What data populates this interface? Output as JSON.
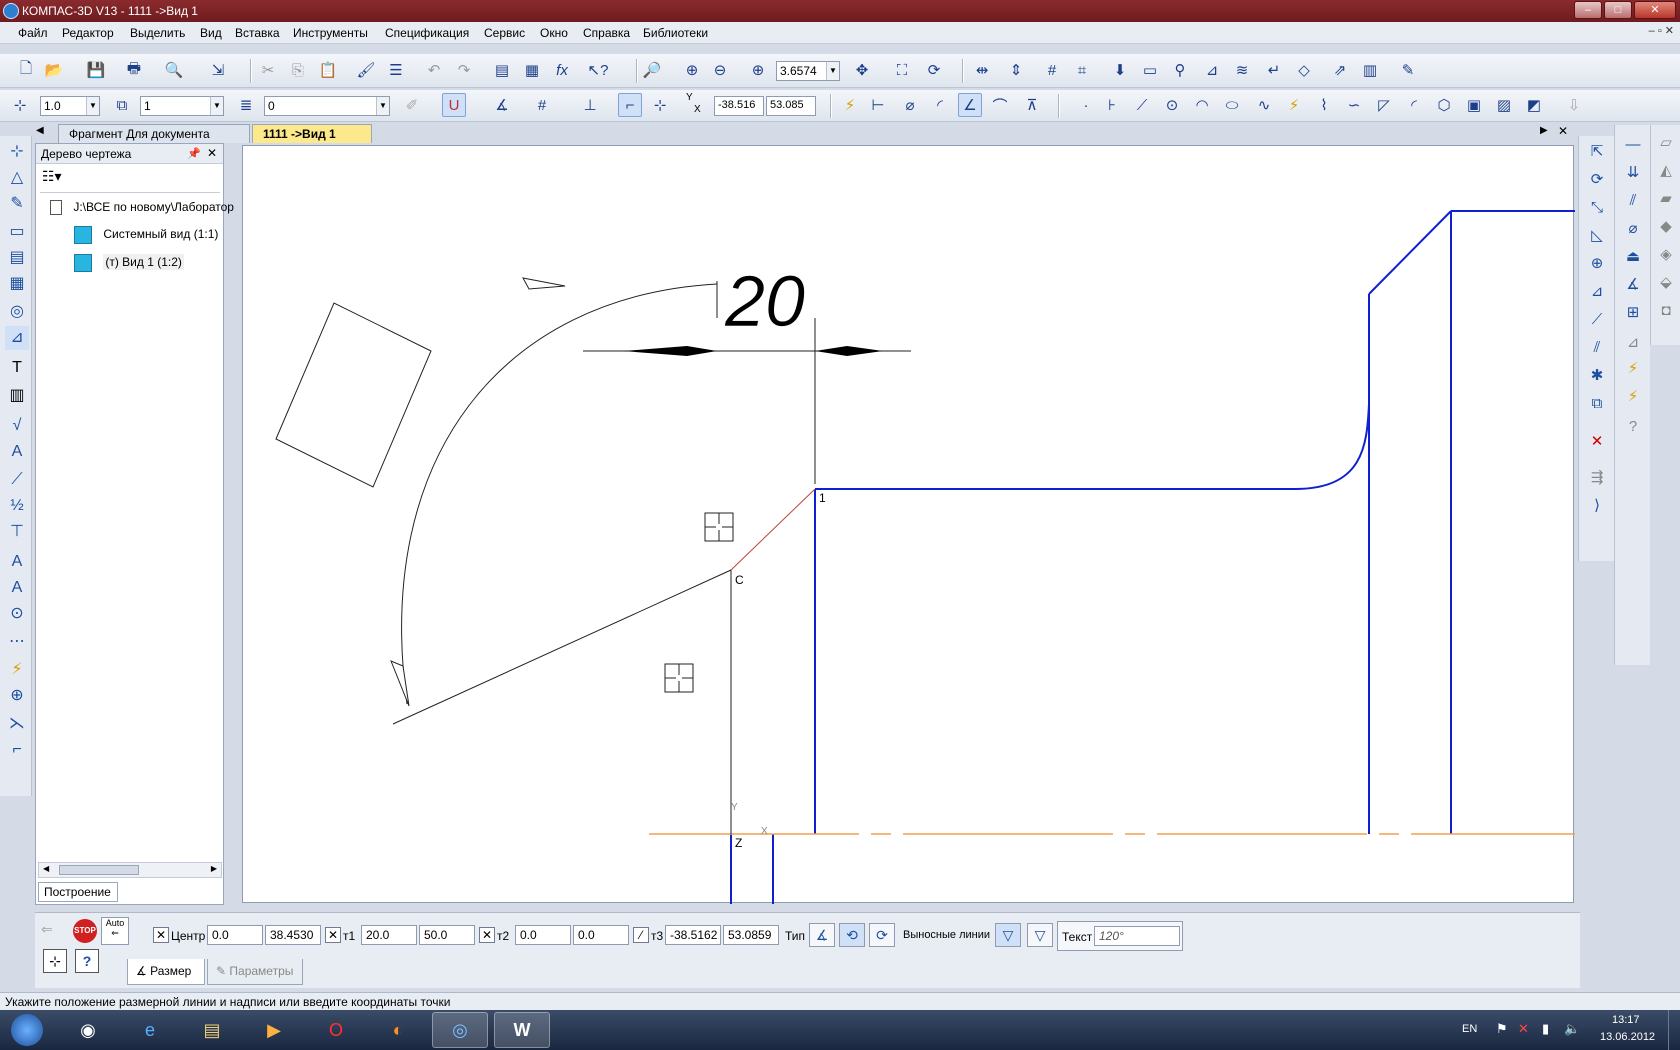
{
  "window": {
    "title": "КОМПАС-3D V13 - 1111 ->Вид 1",
    "min": "–",
    "max": "□",
    "close": "✕"
  },
  "menu": [
    "Файл",
    "Редактор",
    "Выделить",
    "Вид",
    "Вставка",
    "Инструменты",
    "Спецификация",
    "Сервис",
    "Окно",
    "Справка",
    "Библиотеки"
  ],
  "toolbar_main": {
    "zoom_value": "3.6574"
  },
  "toolbar_current": {
    "line_scale": "1.0",
    "style": "1",
    "layer": "0",
    "coord_label_x": "X",
    "coord_label_y": "Y",
    "cursor_x": "-38.516",
    "cursor_y": "53.085"
  },
  "tabs": [
    {
      "label": "Фрагмент Для документа",
      "active": false
    },
    {
      "label": "1111 ->Вид 1",
      "active": true
    }
  ],
  "tree": {
    "title": "Дерево чертежа",
    "root": "J:\\ВСЕ по новому\\Лаборатор",
    "items": [
      "Системный вид (1:1)",
      "(т) Вид 1 (1:2)"
    ],
    "bottom_tab": "Построение"
  },
  "canvas": {
    "dimension_text": "20",
    "point_label_1": "1",
    "point_label_c": "C",
    "point_label_z": "Z",
    "axis_label_x": "X",
    "axis_label_y": "Y",
    "colors": {
      "geometry": "#0000cc",
      "axis": "#f0a050",
      "thin": "#000000",
      "highlight": "#c04040"
    }
  },
  "properties": {
    "center_label": "Центр",
    "center_x": "0.0",
    "center_y": "38.4530",
    "t1_label": "т1",
    "t1_x": "20.0",
    "t1_y": "50.0",
    "t2_label": "т2",
    "t2_x": "0.0",
    "t2_y": "0.0",
    "t3_label": "т3",
    "t3_x": "-38.5162",
    "t3_y": "53.0859",
    "type_label": "Тип",
    "ext_lines_label": "Выносные линии",
    "text_label": "Текст",
    "text_value": "120°",
    "auto_label": "Auto",
    "stop_label": "STOP",
    "tab_size": "Размер",
    "tab_params": "Параметры"
  },
  "status": "Укажите положение размерной линии и надписи или введите координаты точки",
  "taskbar": {
    "lang": "EN",
    "time": "13:17",
    "date": "13.06.2012"
  }
}
